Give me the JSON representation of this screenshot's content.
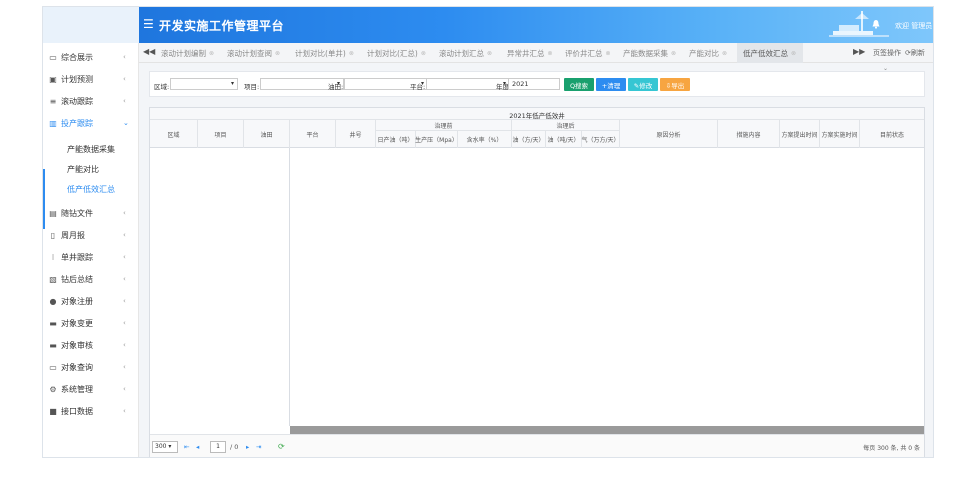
{
  "header": {
    "menu_icon": "☰",
    "title": "开发实施工作管理平台",
    "welcome": "欢迎 管理员"
  },
  "sidebar": {
    "items": [
      {
        "label": "综合展示",
        "icon": "dashboard-icon",
        "active": false
      },
      {
        "label": "计划预测",
        "icon": "calendar-icon",
        "active": false
      },
      {
        "label": "滚动跟踪",
        "icon": "list-icon",
        "active": false
      },
      {
        "label": "投产跟踪",
        "icon": "bar-chart-icon",
        "active": true
      },
      {
        "label": "随钻文件",
        "icon": "file-icon",
        "active": false
      },
      {
        "label": "周月报",
        "icon": "report-icon",
        "active": false
      },
      {
        "label": "单井跟踪",
        "icon": "well-icon",
        "active": false
      },
      {
        "label": "钻后总结",
        "icon": "summary-icon",
        "active": false
      },
      {
        "label": "对象注册",
        "icon": "users-icon",
        "active": false
      },
      {
        "label": "对象变更",
        "icon": "edit-card-icon",
        "active": false
      },
      {
        "label": "对象审核",
        "icon": "audit-icon",
        "active": false
      },
      {
        "label": "对象查询",
        "icon": "search-card-icon",
        "active": false
      },
      {
        "label": "系统管理",
        "icon": "gear-icon",
        "active": false
      },
      {
        "label": "接口数据",
        "icon": "database-icon",
        "active": false
      }
    ],
    "subitems": [
      {
        "label": "产能数据采集",
        "active": false
      },
      {
        "label": "产能对比",
        "active": false
      },
      {
        "label": "低产低效汇总",
        "active": true
      }
    ]
  },
  "tabs": {
    "items": [
      {
        "label": "滚动计划编制",
        "active": false
      },
      {
        "label": "滚动计划查阅",
        "active": false
      },
      {
        "label": "计划对比(单井)",
        "active": false
      },
      {
        "label": "计划对比(汇总)",
        "active": false
      },
      {
        "label": "滚动计划汇总",
        "active": false
      },
      {
        "label": "异常井汇总",
        "active": false
      },
      {
        "label": "评价井汇总",
        "active": false
      },
      {
        "label": "产能数据采集",
        "active": false
      },
      {
        "label": "产能对比",
        "active": false
      },
      {
        "label": "低产低效汇总",
        "active": true
      }
    ],
    "ops_label": "页签操作",
    "refresh_label": "刷新"
  },
  "filter": {
    "region_label": "区域:",
    "project_label": "项目:",
    "oilfield_label": "油田:",
    "platform_label": "平台:",
    "year_label": "年度:",
    "year_value": "2021",
    "search_label": "Q搜索",
    "clear_label": "+清理",
    "edit_label": "✎修改",
    "export_label": "⇩导出"
  },
  "grid": {
    "title": "2021年低产低效井",
    "columns": {
      "region": "区域",
      "project": "项目",
      "oilfield": "油田",
      "platform": "平台",
      "well": "井号",
      "before": "治理前",
      "after": "治理后",
      "before_daily_oil": "日产油（吨）",
      "before_pressure": "生产压（Mpa）",
      "before_water_cut": "含水率（%）",
      "after_oil": "油（方/天）",
      "after_oil_ton": "油（吨/天）",
      "after_gas": "气（万方/天）",
      "cause": "原因分析",
      "measures": "措施内容",
      "plan_time": "方案提出时间",
      "impl_time": "方案实施时间",
      "status": "目前状态"
    }
  },
  "pager": {
    "page_size": "300",
    "current_page": "1",
    "total_pages": "/ 0",
    "info": "每页 300 条, 共 0 条"
  },
  "colors": {
    "accent": "#2d8cf0",
    "search": "#19a06e",
    "clear": "#2d8cf0",
    "edit": "#36c6d3",
    "export": "#f7a541"
  }
}
